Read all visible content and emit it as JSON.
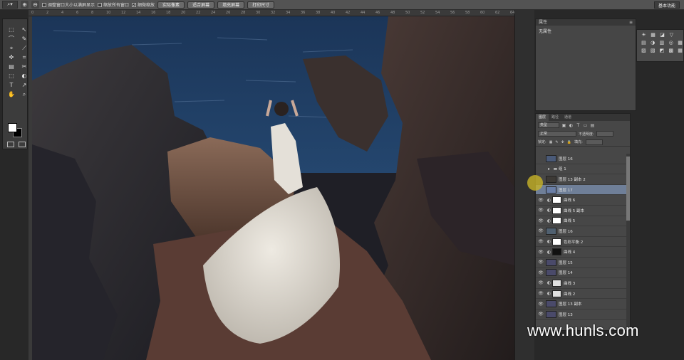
{
  "options_bar": {
    "tool_preset": "⌕▾",
    "zoom_in": "⊕",
    "zoom_out": "⊖",
    "resize_windows_label": "调整窗口大小以满屏显示",
    "zoom_all_windows_label": "缩放所有窗口",
    "scrubby_zoom_label": "细微缩放",
    "scrubby_zoom_checked": "✓",
    "actual_pixels": "实际像素",
    "fit_screen": "适合屏幕",
    "fill_screen": "填充屏幕",
    "print_size": "打印尺寸",
    "workspace": "基本功能"
  },
  "ruler": [
    "0",
    "2",
    "4",
    "6",
    "8",
    "10",
    "12",
    "14",
    "16",
    "18",
    "20",
    "22",
    "24",
    "26",
    "28",
    "30",
    "32",
    "34",
    "36",
    "38",
    "40",
    "42",
    "44",
    "46",
    "48",
    "50",
    "52",
    "54",
    "56",
    "58",
    "60",
    "62",
    "64"
  ],
  "properties": {
    "title": "属性",
    "content": "无属性"
  },
  "adjustments": {
    "row1": [
      "☀",
      "▦",
      "◪",
      "▽"
    ],
    "row2": [
      "▤",
      "◑",
      "▥",
      "◎",
      "▦"
    ],
    "row3": [
      "▨",
      "▧",
      "◩",
      "▩",
      "▦"
    ]
  },
  "layers": {
    "tabs": [
      "图层",
      "路径",
      "通道"
    ],
    "filter_kind": "类型",
    "blend_mode": "正常",
    "opacity_label": "不透明度:",
    "lock_label": "锁定:",
    "fill_label": "填充:",
    "items": [
      {
        "name": "图层 16",
        "kind": "pixel",
        "eye": "",
        "thumb": "#4a5a78"
      },
      {
        "name": "组 1",
        "kind": "group",
        "eye": "",
        "thumb": ""
      },
      {
        "name": "图层 13 副本 2",
        "kind": "pixel",
        "eye": "",
        "thumb": "#3d3a36"
      },
      {
        "name": "图层 17",
        "kind": "pixel",
        "eye": "",
        "thumb": "#6a7ea6",
        "selected": true
      },
      {
        "name": "曲线 6",
        "kind": "adj",
        "eye": "👁",
        "thumb": "#ffffff"
      },
      {
        "name": "曲线 5 副本",
        "kind": "adj",
        "eye": "👁",
        "thumb": "#ffffff"
      },
      {
        "name": "曲线 5",
        "kind": "adj",
        "eye": "👁",
        "thumb": "#ffffff"
      },
      {
        "name": "图层 16",
        "kind": "pixel",
        "eye": "👁",
        "thumb": "#506070"
      },
      {
        "name": "色彩平衡 2",
        "kind": "adj",
        "eye": "👁",
        "thumb": "#ffffff"
      },
      {
        "name": "曲线 4",
        "kind": "adj",
        "eye": "👁",
        "thumb": "#111111"
      },
      {
        "name": "图层 15",
        "kind": "pixel",
        "eye": "👁",
        "thumb": "#4a4a6a"
      },
      {
        "name": "图层 14",
        "kind": "pixel",
        "eye": "👁",
        "thumb": "#4a4a6a"
      },
      {
        "name": "曲线 3",
        "kind": "adj",
        "eye": "👁",
        "thumb": "#e0e0e0"
      },
      {
        "name": "曲线 2",
        "kind": "adj",
        "eye": "👁",
        "thumb": "#e0e0e0"
      },
      {
        "name": "图层 13 副本",
        "kind": "pixel",
        "eye": "👁",
        "thumb": "#4a4a6a"
      },
      {
        "name": "图层 13",
        "kind": "pixel",
        "eye": "👁",
        "thumb": "#4a4a6a"
      }
    ]
  },
  "toolbox": {
    "tools": [
      "⬚",
      "↖",
      "⌒",
      "✎",
      "⌖",
      "⟋",
      "✜",
      "⌗",
      "▤",
      "✂",
      "⬚",
      "◐",
      "T",
      "↗",
      "✋",
      "⌕"
    ],
    "foreground": "#ffffff",
    "background": "#000000"
  },
  "watermark": "www.hunls.com"
}
